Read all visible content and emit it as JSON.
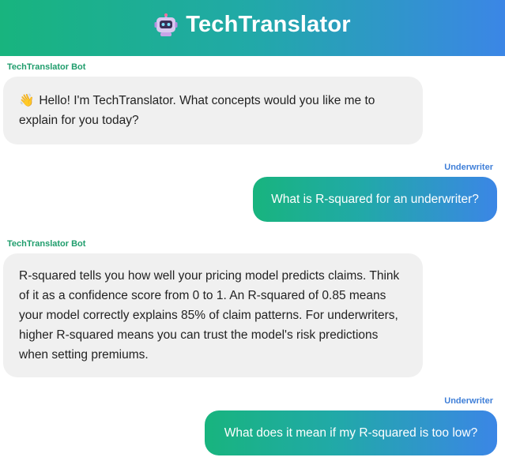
{
  "header": {
    "title": "TechTranslator",
    "icon": "robot-icon"
  },
  "messages": [
    {
      "role": "bot",
      "sender": "TechTranslator Bot",
      "icon": "waving-hand-icon",
      "text": "Hello! I'm TechTranslator. What concepts would you like me to explain for you today?"
    },
    {
      "role": "user",
      "sender": "Underwriter",
      "text": "What is R-squared for an underwriter?"
    },
    {
      "role": "bot",
      "sender": "TechTranslator Bot",
      "text": "R-squared tells you how well your pricing model predicts claims. Think of it as a confidence score from 0 to 1. An R-squared of 0.85 means your model correctly explains 85% of claim patterns. For underwriters, higher R-squared means you can trust the model's risk predictions when setting premiums."
    },
    {
      "role": "user",
      "sender": "Underwriter",
      "text": "What does it mean if my R-squared is too low?"
    }
  ],
  "colors": {
    "accent_green": "#18b47e",
    "accent_blue": "#3b86e6",
    "bot_bubble": "#f0f0f0",
    "bot_label": "#1f9d6c",
    "user_label": "#3f7fd8"
  }
}
